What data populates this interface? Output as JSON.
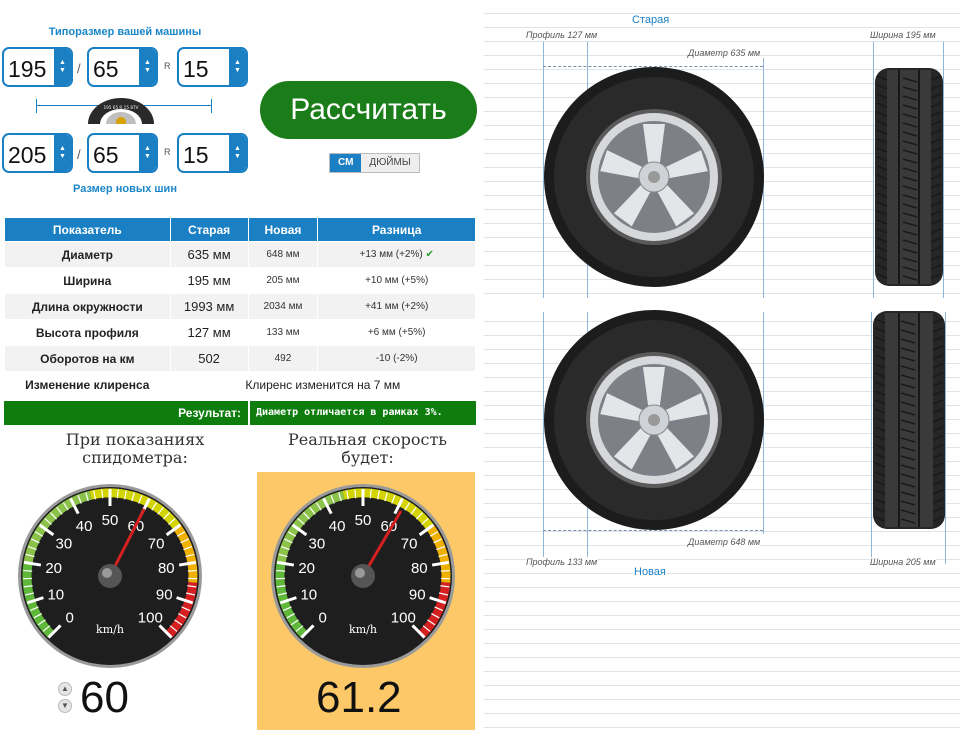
{
  "old_size": {
    "caption": "Типоразмер вашей машины",
    "width": "195",
    "profile": "65",
    "radius_prefix": "R",
    "rim": "15",
    "separator": "/"
  },
  "new_size": {
    "caption": "Размер новых шин",
    "width": "205",
    "profile": "65",
    "radius_prefix": "R",
    "rim": "15",
    "separator": "/"
  },
  "calculate_button": "Рассчитать",
  "units": {
    "cm": "СМ",
    "inches": "ДЮЙМЫ",
    "selected": "cm"
  },
  "table": {
    "headers": [
      "Показатель",
      "Старая",
      "Новая",
      "Разница"
    ],
    "rows": [
      {
        "label": "Диаметр",
        "old": "635 мм",
        "new": "648 мм",
        "diff": "+13 мм (+2%)",
        "check": "✔"
      },
      {
        "label": "Ширина",
        "old": "195 мм",
        "new": "205 мм",
        "diff": "+10 мм (+5%)",
        "check": ""
      },
      {
        "label": "Длина окружности",
        "old": "1993 мм",
        "new": "2034 мм",
        "diff": "+41 мм (+2%)",
        "check": ""
      },
      {
        "label": "Высота профиля",
        "old": "127 мм",
        "new": "133 мм",
        "diff": "+6 мм (+5%)",
        "check": ""
      },
      {
        "label": "Оборотов на км",
        "old": "502",
        "new": "492",
        "diff": "-10 (-2%)",
        "check": ""
      }
    ],
    "clearance_label": "Изменение клиренса",
    "clearance_value": "Клиренс изменится на 7 мм",
    "result_label": "Результат:",
    "result_value": "Диаметр отличается в рамках 3%."
  },
  "speedometer": {
    "shown_label": "При показаниях спидометра:",
    "real_label": "Реальная скорость будет:",
    "shown_value": 60,
    "shown_text": "60",
    "real_value": 61.2,
    "real_text": "61.2",
    "unit": "km/h",
    "ticks": [
      "0",
      "10",
      "20",
      "30",
      "40",
      "50",
      "60",
      "70",
      "80",
      "90",
      "100"
    ],
    "highlight_color": "#fcc868"
  },
  "visual": {
    "old_title": "Старая",
    "new_title": "Новая",
    "old_profile": "Профиль 127 мм",
    "old_diameter": "Диаметр 635 мм",
    "old_width": "Ширина 195 мм",
    "new_profile": "Профиль 133 мм",
    "new_diameter": "Диаметр 648 мм",
    "new_width": "Ширина 205 мм"
  },
  "mini_tire_text": "195 65 R 15 87V",
  "colors": {
    "accent": "#1b7fc4",
    "calc_button": "#1a7d1a",
    "result_bar": "#0e7d0e",
    "needle": "#d42020"
  }
}
